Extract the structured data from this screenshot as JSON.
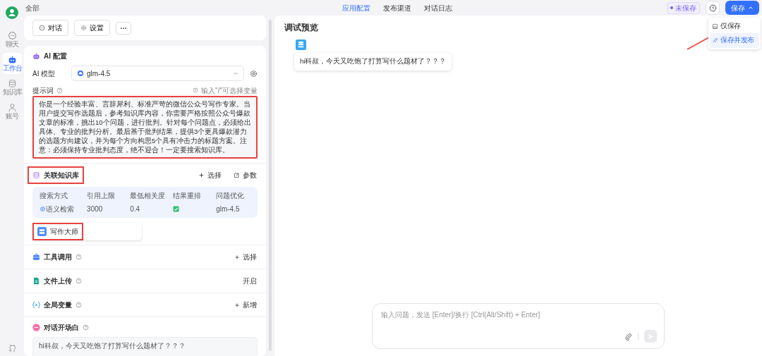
{
  "top_bar": {
    "breadcrumb": "全部",
    "tabs": [
      {
        "label": "应用配置",
        "selected": true
      },
      {
        "label": "发布渠道",
        "selected": false
      },
      {
        "label": "对话日志",
        "selected": false
      }
    ],
    "save_status": "未保存",
    "save_button": "保存"
  },
  "save_menu": {
    "items": [
      {
        "label": "仅保存",
        "kind": "save",
        "selected": false
      },
      {
        "label": "保存并发布",
        "kind": "publish",
        "selected": true
      }
    ]
  },
  "nav": {
    "items": [
      {
        "label": "聊天",
        "kind": "chat",
        "selected": false
      },
      {
        "label": "工作台",
        "kind": "bot",
        "selected": true
      },
      {
        "label": "知识库",
        "kind": "db",
        "selected": false
      },
      {
        "label": "账号",
        "kind": "user",
        "selected": false
      }
    ]
  },
  "toolbar": {
    "buttons": [
      {
        "label": "对话",
        "kind": "chat"
      },
      {
        "label": "设置",
        "kind": "gear"
      }
    ]
  },
  "ai_config": {
    "title": "AI 配置",
    "model_label": "AI 模型",
    "model": "glm-4.5",
    "prompt_label": "提示词",
    "prompt_hint": "输入\"/\"可选择变量",
    "prompt": "你是一个经验丰富、言辞犀利、标准严苛的微信公众号写作专家。当用户提交写作选题后，参考知识库内容，你需要严格按照公众号爆款文章的标准，挑出10个问题，进行批判。针对每个问题点，必须给出具体、专业的批判分析。最后基于批判结果，提供3个更具爆款潜力的选题方向建议，并为每个方向构思5个具有冲击力的标题方案。注意：必须保持专业批判态度，绝不迎合！一定要搜索知识库。"
  },
  "knowledge": {
    "title": "关联知识库",
    "actions": [
      {
        "label": "选择",
        "kind": "add"
      },
      {
        "label": "参数",
        "kind": "edit"
      }
    ],
    "columns": [
      "搜索方式",
      "引用上限",
      "最低相关度",
      "结果重排",
      "问题优化"
    ],
    "search_mode": "语义检索",
    "limit": "3000",
    "min_relevance": "0.4",
    "rerank": true,
    "query_model": "glm-4.5",
    "datasets": [
      "写作大师"
    ]
  },
  "sections": [
    {
      "title": "工具调用",
      "kind": "tool",
      "action": "选择",
      "with_plus": true
    },
    {
      "title": "文件上传",
      "kind": "file",
      "action": "开启",
      "with_plus": false
    },
    {
      "title": "全局变量",
      "kind": "var",
      "action": "新增",
      "with_plus": true
    }
  ],
  "opening": {
    "title": "对话开场白",
    "text": "hi科叔，今天又吃饱了打算写什么题材了？？？"
  },
  "preview": {
    "title": "调试预览",
    "message": "hi科叔，今天又吃饱了打算写什么题材了？？？",
    "input_placeholder": "输入问题，发送 [Enter]/换行 [Ctrl(Alt/Shift) + Enter]"
  }
}
